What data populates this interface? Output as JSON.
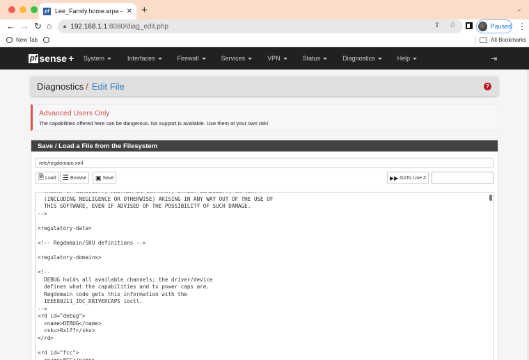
{
  "browser": {
    "tab_title": "Lee_Family.home.arpa - Diagn",
    "tab_favicon": "pf",
    "url_host": "192.168.1.1",
    "url_path": ":8080/diag_edit.php",
    "profile_label": "Paused",
    "bookmarks": [
      {
        "label": "New Tab",
        "icon": "globe-icon"
      },
      {
        "label": "",
        "icon": "globe-icon"
      }
    ],
    "all_bookmarks_label": "All Bookmarks"
  },
  "navbar": {
    "logo_pf": "pf",
    "logo_sense": "sense",
    "logo_plus": "+",
    "menu": [
      {
        "label": "System"
      },
      {
        "label": "Interfaces"
      },
      {
        "label": "Firewall"
      },
      {
        "label": "Services"
      },
      {
        "label": "VPN"
      },
      {
        "label": "Status"
      },
      {
        "label": "Diagnostics"
      },
      {
        "label": "Help"
      }
    ],
    "logout_icon": "sign-out-icon"
  },
  "page": {
    "breadcrumb_parent": "Diagnostics",
    "breadcrumb_separator": "/",
    "breadcrumb_current": "Edit File",
    "help_icon": "?"
  },
  "alert": {
    "title": "Advanced Users Only",
    "text": "The capabilities offered here can be dangerous. No support is available. Use them at your own risk!"
  },
  "panel": {
    "heading": "Save / Load a File from the Filesystem",
    "file_path": "/etc/regdomain.xml",
    "buttons": {
      "load": "Load",
      "browse": "Browse",
      "save": "Save",
      "goto": "GoTo Line #"
    },
    "goto_value": "",
    "editor_lines": [
      "  THEORY OF LIABILITY, WHETHER IN CONTRACT, STRICT LIABILITY, OR TORT",
      "  (INCLUDING NEGLIGENCE OR OTHERWISE) ARISING IN ANY WAY OUT OF THE USE OF",
      "  THIS SOFTWARE, EVEN IF ADVISED OF THE POSSIBILITY OF SUCH DAMAGE.",
      "-->",
      "",
      "<regulatory-data>",
      "",
      "<!-- Regdomain/SKU definitions -->",
      "",
      "<regulatory-domains>",
      "",
      "<!--",
      "  DEBUG holds all available channels; the driver/device",
      "  defines what the capabilities and tx power caps are.",
      "  Regdomain code gets this information with the",
      "  IEEE80211_IOC_DRIVERCAPS ioctl.",
      "-->",
      "<rd id=\"debug\">",
      "  <name>DEBUG</name>",
      "  <sku>0x1ff</sku>",
      "</rd>",
      "",
      "<rd id=\"fcc\">",
      "  <name>FCC</name>"
    ]
  }
}
